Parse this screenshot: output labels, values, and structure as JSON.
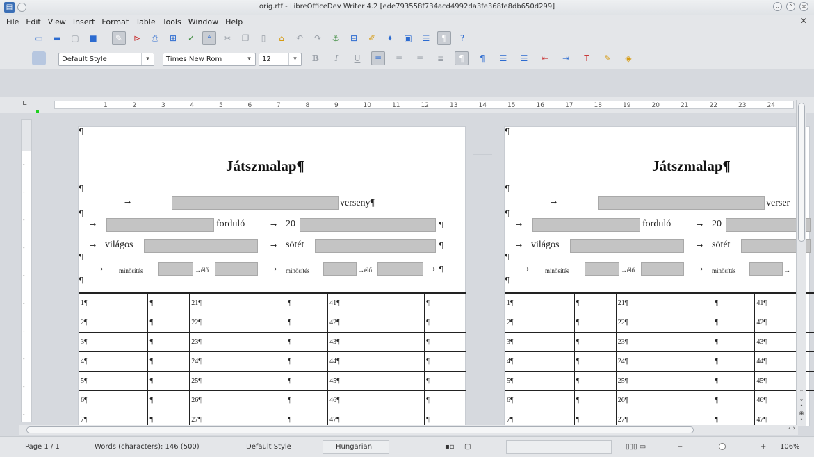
{
  "window": {
    "title": "orig.rtf - LibreOfficeDev Writer 4.2 [ede793558f734acd4992da3fe368fe8db650d299]"
  },
  "menu": [
    "File",
    "Edit",
    "View",
    "Insert",
    "Format",
    "Table",
    "Tools",
    "Window",
    "Help"
  ],
  "toolbar": {
    "paragraph_style": "Default Style",
    "font_name": "Times New Rom",
    "font_size": "12"
  },
  "ruler": {
    "ticks": [
      "1",
      "2",
      "3",
      "4",
      "5",
      "6",
      "7",
      "8",
      "9",
      "10",
      "11",
      "12",
      "13",
      "14",
      "15",
      "16",
      "17",
      "18",
      "19",
      "20",
      "21",
      "22",
      "23",
      "24"
    ]
  },
  "document": {
    "pilcrow": "¶",
    "title": "Játszmalap¶",
    "verseny": "verseny¶",
    "verseny_cut": "verser",
    "fordulo": "forduló",
    "year_prefix": "20",
    "vilagos": "világos",
    "sotet": "sötét",
    "minosites": "minősítés",
    "elo": "élő",
    "tab_arrow": "→",
    "rows": [
      [
        "1¶",
        "¶",
        "21¶",
        "¶",
        "41¶",
        "¶"
      ],
      [
        "2¶",
        "¶",
        "22¶",
        "¶",
        "42¶",
        "¶"
      ],
      [
        "3¶",
        "¶",
        "23¶",
        "¶",
        "43¶",
        "¶"
      ],
      [
        "4¶",
        "¶",
        "24¶",
        "¶",
        "44¶",
        "¶"
      ],
      [
        "5¶",
        "¶",
        "25¶",
        "¶",
        "45¶",
        "¶"
      ],
      [
        "6¶",
        "¶",
        "26¶",
        "¶",
        "46¶",
        "¶"
      ],
      [
        "7¶",
        "¶",
        "27¶",
        "¶",
        "47¶",
        "¶"
      ]
    ]
  },
  "status": {
    "page": "Page 1 / 1",
    "words": "Words (characters): 146 (500)",
    "style": "Default Style",
    "language": "Hungarian",
    "zoom": "106%",
    "zoom_minus": "−",
    "zoom_plus": "+"
  },
  "colors": {
    "field_gray": "#c4c4c4",
    "chrome": "#e4e6e9"
  }
}
